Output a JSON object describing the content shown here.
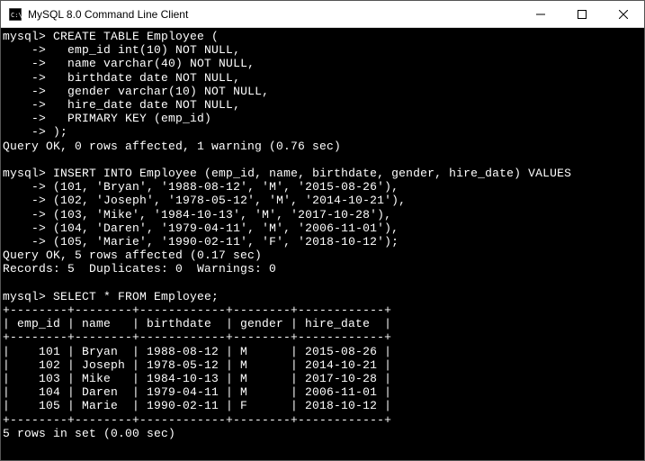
{
  "window": {
    "title": "MySQL 8.0 Command Line Client"
  },
  "terminal": {
    "prompt": "mysql>",
    "cont": "    ->",
    "create_table": {
      "stmt_open": "CREATE TABLE Employee (",
      "col1": "  emp_id int(10) NOT NULL,",
      "col2": "  name varchar(40) NOT NULL,",
      "col3": "  birthdate date NOT NULL,",
      "col4": "  gender varchar(10) NOT NULL,",
      "col5": "  hire_date date NOT NULL,",
      "pk": "  PRIMARY KEY (emp_id)",
      "close": ");"
    },
    "create_result": "Query OK, 0 rows affected, 1 warning (0.76 sec)",
    "insert": {
      "stmt_open": "INSERT INTO Employee (emp_id, name, birthdate, gender, hire_date) VALUES",
      "r1": "(101, 'Bryan', '1988-08-12', 'M', '2015-08-26'),",
      "r2": "(102, 'Joseph', '1978-05-12', 'M', '2014-10-21'),",
      "r3": "(103, 'Mike', '1984-10-13', 'M', '2017-10-28'),",
      "r4": "(104, 'Daren', '1979-04-11', 'M', '2006-11-01'),",
      "r5": "(105, 'Marie', '1990-02-11', 'F', '2018-10-12');"
    },
    "insert_result1": "Query OK, 5 rows affected (0.17 sec)",
    "insert_result2": "Records: 5  Duplicates: 0  Warnings: 0",
    "select_stmt": "SELECT * FROM Employee;",
    "table": {
      "border": "+--------+--------+------------+--------+------------+",
      "header": "| emp_id | name   | birthdate  | gender | hire_date  |",
      "rows": [
        "|    101 | Bryan  | 1988-08-12 | M      | 2015-08-26 |",
        "|    102 | Joseph | 1978-05-12 | M      | 2014-10-21 |",
        "|    103 | Mike   | 1984-10-13 | M      | 2017-10-28 |",
        "|    104 | Daren  | 1979-04-11 | M      | 2006-11-01 |",
        "|    105 | Marie  | 1990-02-11 | F      | 2018-10-12 |"
      ]
    },
    "select_result": "5 rows in set (0.00 sec)"
  }
}
